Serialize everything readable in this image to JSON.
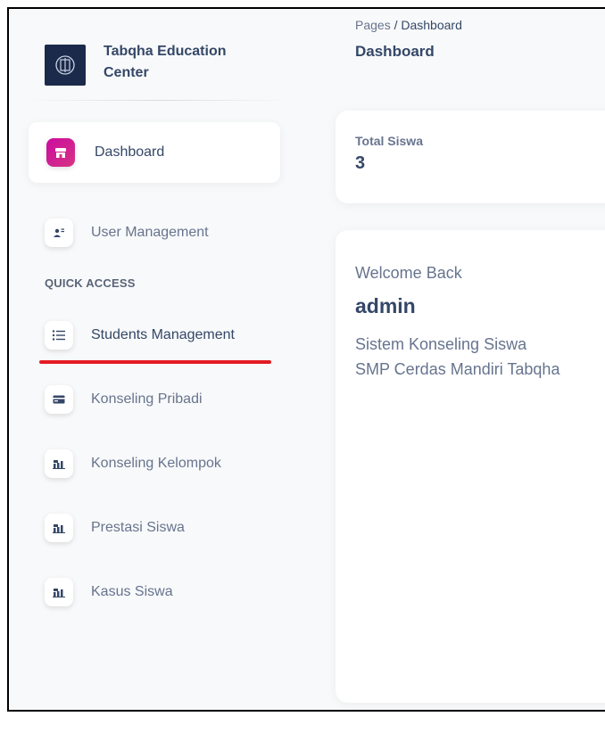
{
  "brand": {
    "name_line1": "Tabqha Education",
    "name_line2": "Center"
  },
  "sidebar": {
    "active_item": {
      "label": "Dashboard",
      "icon": "shop-icon"
    },
    "items": [
      {
        "label": "User Management",
        "icon": "user-icon"
      },
      {
        "label": "Students Management",
        "icon": "list-icon"
      },
      {
        "label": "Konseling Pribadi",
        "icon": "card-icon"
      },
      {
        "label": "Konseling Kelompok",
        "icon": "chart-icon"
      },
      {
        "label": "Prestasi Siswa",
        "icon": "chart-icon"
      },
      {
        "label": "Kasus Siswa",
        "icon": "chart-icon"
      }
    ],
    "section_title": "QUICK ACCESS"
  },
  "header": {
    "breadcrumb_root": "Pages",
    "breadcrumb_sep": "/",
    "breadcrumb_current": "Dashboard",
    "title": "Dashboard"
  },
  "stats": {
    "label": "Total Siswa",
    "value": "3"
  },
  "welcome": {
    "subtitle": "Welcome Back",
    "user": "admin",
    "line1": "Sistem Konseling Siswa",
    "line2": "SMP Cerdas Mandiri Tabqha"
  },
  "colors": {
    "accent": "#cb0c9f",
    "annotation": "#e31b23",
    "text": "#344767",
    "muted": "#67748e"
  }
}
